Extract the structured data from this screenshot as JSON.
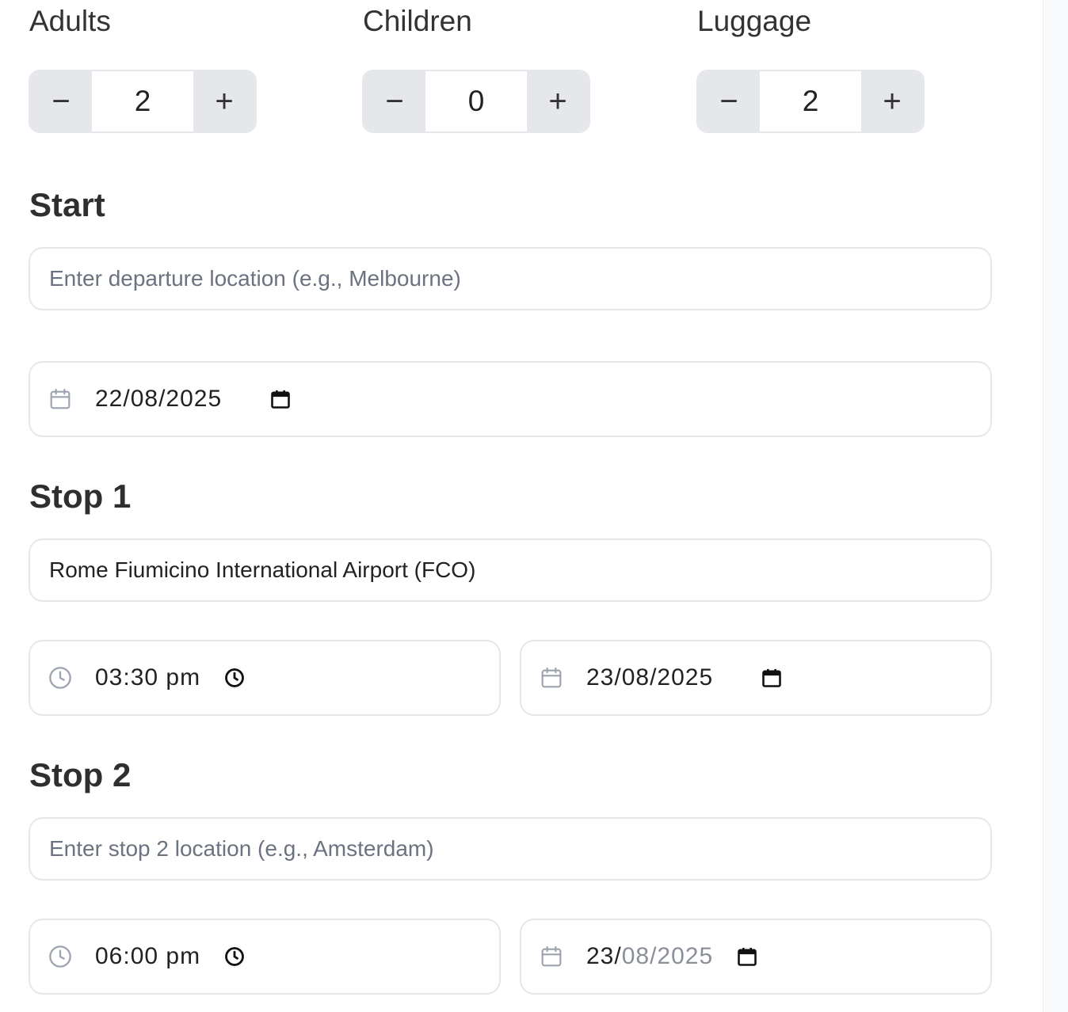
{
  "counters": {
    "adults": {
      "label": "Adults",
      "value": "2",
      "minus": "−",
      "plus": "+"
    },
    "children": {
      "label": "Children",
      "value": "0",
      "minus": "−",
      "plus": "+"
    },
    "luggage": {
      "label": "Luggage",
      "value": "2",
      "minus": "−",
      "plus": "+"
    }
  },
  "start": {
    "title": "Start",
    "location_placeholder": "Enter departure location (e.g., Melbourne)",
    "date": "22/08/2025"
  },
  "stop1": {
    "title": "Stop 1",
    "location_value": "Rome Fiumicino International Airport (FCO)",
    "time": "03:30 pm",
    "date": "23/08/2025"
  },
  "stop2": {
    "title": "Stop 2",
    "location_placeholder": "Enter stop 2 location (e.g., Amsterdam)",
    "time": "06:00 pm",
    "date_day": "23/",
    "date_rest": "08/2025"
  },
  "icons": {
    "minus": "minus-icon",
    "plus": "plus-icon",
    "calendar": "calendar-icon",
    "clock": "clock-icon",
    "calendar_picker": "calendar-picker-icon",
    "clock_picker": "clock-picker-icon"
  },
  "colors": {
    "button_bg": "#e5e7eb",
    "border": "#e5e7eb",
    "icon": "#9ca3af",
    "text": "#333333",
    "placeholder": "#6b7280"
  }
}
